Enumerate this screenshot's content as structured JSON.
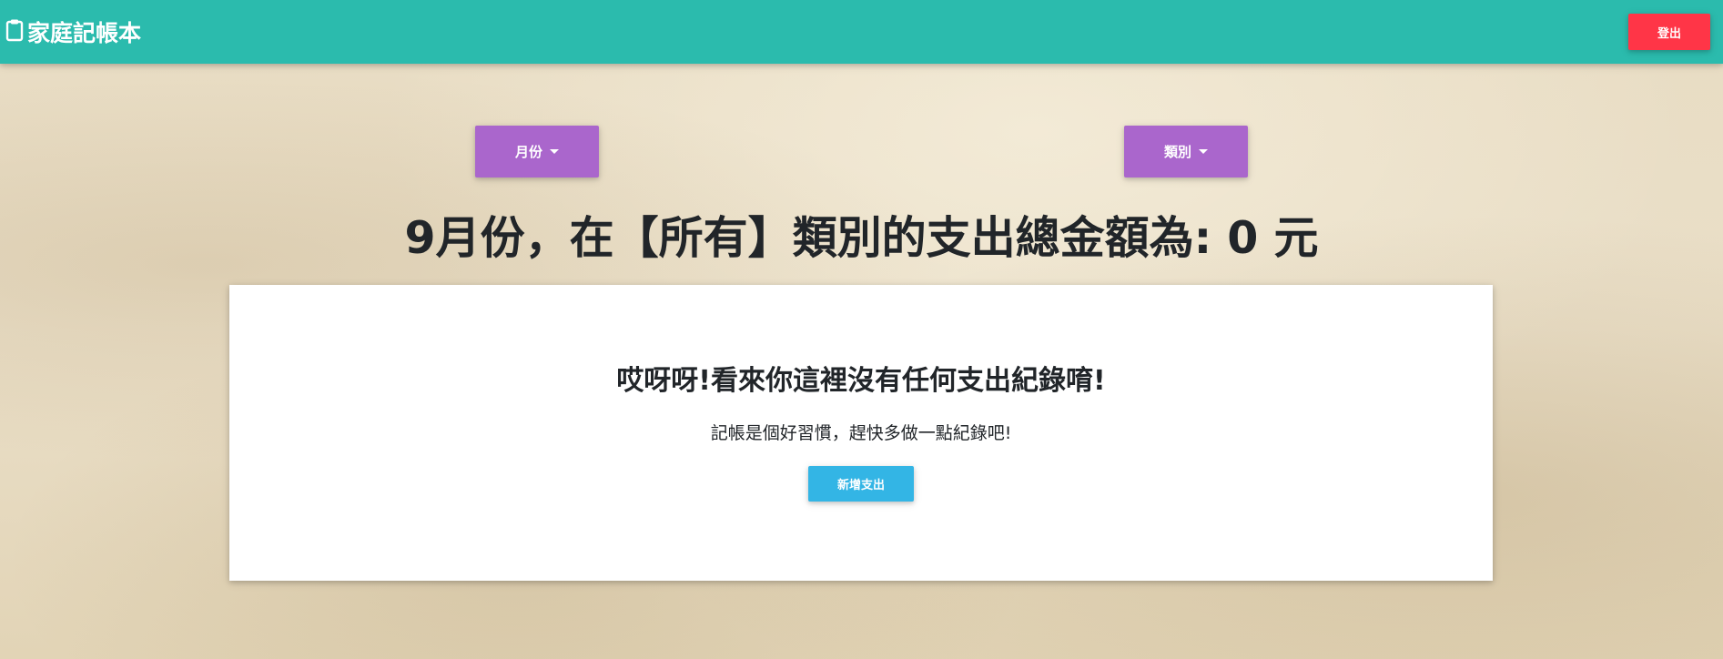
{
  "navbar": {
    "brand_icon": "clipboard-icon",
    "brand_text": "家庭記帳本",
    "logout_label": "登出",
    "bg_color": "#2bbbad",
    "logout_color": "#ff3547"
  },
  "filters": {
    "month_label": "月份",
    "category_label": "類別",
    "button_color": "#aa66cc",
    "caret_icon": "caret-down-icon"
  },
  "summary": {
    "text": "9月份，在【所有】類別的支出總金額為: 0 元"
  },
  "empty_state": {
    "title": "哎呀呀!看來你這裡沒有任何支出紀錄唷!",
    "subtitle": "記帳是個好習慣，趕快多做一點紀錄吧!",
    "add_label": "新增支出",
    "add_color": "#33b5e5"
  }
}
